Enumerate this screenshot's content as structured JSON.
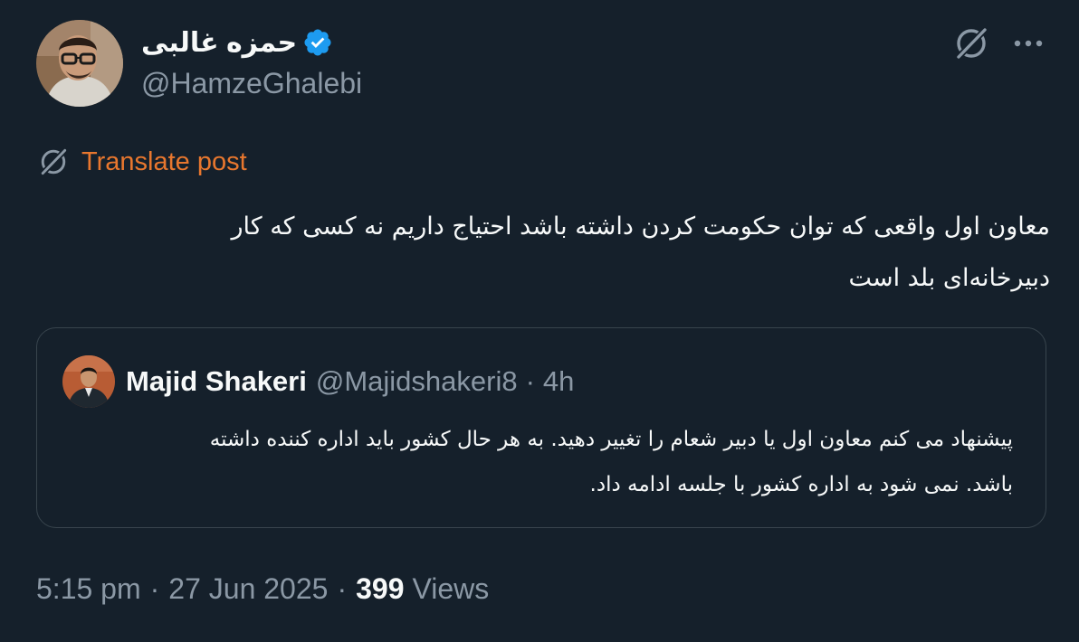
{
  "post": {
    "author": {
      "display_name": "حمزه غالبی",
      "handle": "@HamzeGhalebi",
      "verified": true,
      "verified_color": "#1d9bf0"
    },
    "translate_label": "Translate post",
    "translate_color": "#e8772e",
    "text_line_1": "معاون اول واقعی که توان حکومت کردن داشته باشد احتیاج داریم نه کسی که کار",
    "text_line_2": "دبیرخانه‌ای بلد است",
    "time": "5:15 pm",
    "date": "27 Jun 2025",
    "views_count": "399",
    "views_label": "Views"
  },
  "quote": {
    "display_name": "Majid Shakeri",
    "handle": "@Majidshakeri8",
    "separator": "·",
    "time": "4h",
    "text_line_1": "پیشنهاد می کنم معاون اول یا دبیر شعام را تغییر دهید. به هر حال کشور باید اداره کننده داشته",
    "text_line_2": "باشد. نمی شود به اداره کشور با جلسه ادامه داد."
  },
  "meta": {
    "separator": "·"
  },
  "icons": {
    "verified": "verified-badge-icon",
    "grok": "grok-icon",
    "more": "more-icon",
    "translate": "translate-icon"
  },
  "colors": {
    "background": "#15202b",
    "text": "#f7f9f9",
    "muted": "#8b98a5",
    "border": "#38444d"
  }
}
